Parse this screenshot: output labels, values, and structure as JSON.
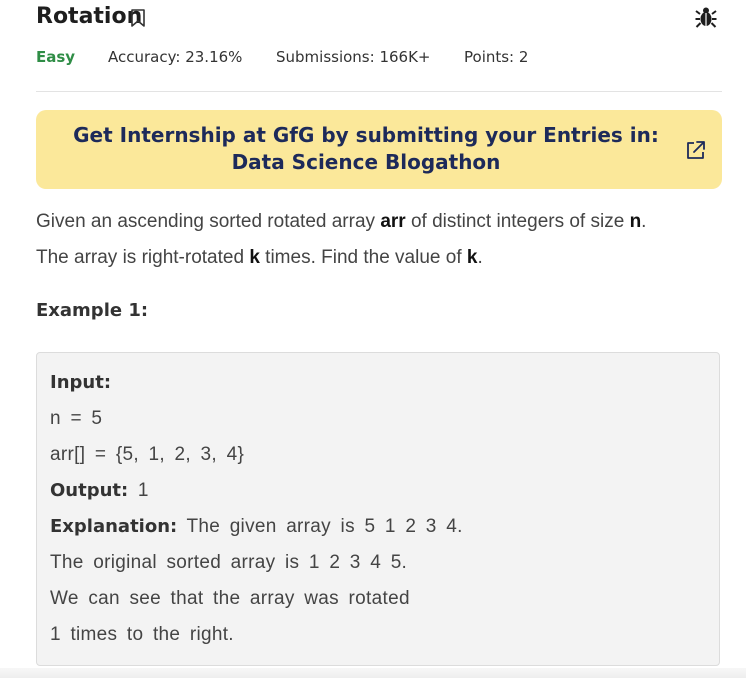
{
  "problem": {
    "title": "Rotation",
    "icons": {
      "bookmark": "bookmark-icon",
      "report": "bug-icon"
    },
    "difficulty": "Easy",
    "accuracy": "Accuracy: 23.16%",
    "submissions": "Submissions: 166K+",
    "points": "Points: 2"
  },
  "banner": {
    "text": "Get Internship at GfG by submitting your Entries in: Data Science Blogathon",
    "icon": "external-link-icon",
    "background": "#fbe89a"
  },
  "description": {
    "part1": "Given an ascending sorted rotated array ",
    "arr": "arr",
    "part2": " of distinct integers of size ",
    "n": "n",
    "part3": ".",
    "part4": "The array is right-rotated ",
    "k1": "k",
    "part5": " times. Find the value of ",
    "k2": "k",
    "part6": "."
  },
  "example": {
    "title": "Example 1:",
    "input_label": "Input:",
    "n_line": "n = 5",
    "arr_line": "arr[] = {5, 1, 2, 3, 4}",
    "output_label": "Output:",
    "output_value": " 1",
    "explanation_label": "Explanation:",
    "explanation_line1": " The given array is 5 1 2 3 4.",
    "explanation_line2": "The original sorted array is 1 2 3 4 5.",
    "explanation_line3": "We can see that the array was rotated",
    "explanation_line4": "1 times to the right."
  },
  "colors": {
    "easy": "#2f8d46",
    "banner_text": "#1d2a5a"
  }
}
